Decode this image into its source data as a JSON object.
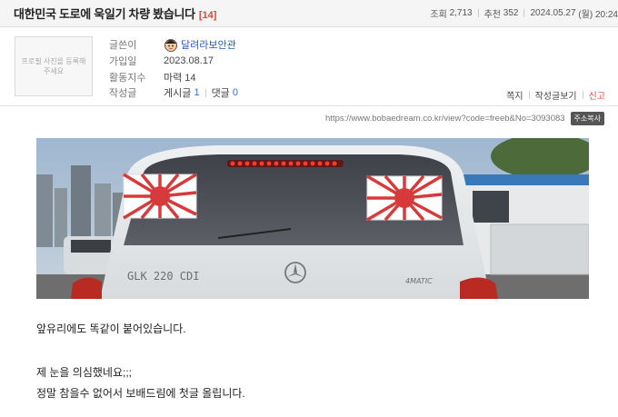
{
  "post": {
    "title": "대한민국 도로에 욱일기 차량 봤습니다",
    "comment_count": "[14]",
    "views_label": "조회",
    "views": "2,713",
    "recommend_label": "추천",
    "recommend": "352",
    "date": "2024.05.27",
    "time": "(월) 20:24"
  },
  "author": {
    "photo_placeholder": "프로필 사진을 등록해주세요",
    "writer_label": "글쓴이",
    "nickname": "달려라보안관",
    "joined_label": "가입일",
    "joined": "2023.08.17",
    "activity_label": "활동지수",
    "activity": "마력 14",
    "posts_label": "작성글",
    "posts_text": "게시글",
    "posts_count": "1",
    "comments_text": "댓글",
    "comments_count": "0"
  },
  "actions": {
    "message": "쪽지",
    "view_posts": "작성글보기",
    "report": "신고"
  },
  "url": {
    "text": "https://www.bobaedream.co.kr/view?code=freeb&No=3093083",
    "copy_label": "주소복사"
  },
  "content": {
    "line1": "앞유리에도 똑같이 붙어있습니다.",
    "line2": "제 눈을 의심했네요;;;",
    "line3": "정말 참을수 없어서 보배드림에 첫글 올립니다.",
    "badge_text": "GLK 220 CDI",
    "badge_text_right": "4MATIC"
  },
  "colors": {
    "accent_red": "#e0443c",
    "link_blue": "#3a6ed6"
  }
}
